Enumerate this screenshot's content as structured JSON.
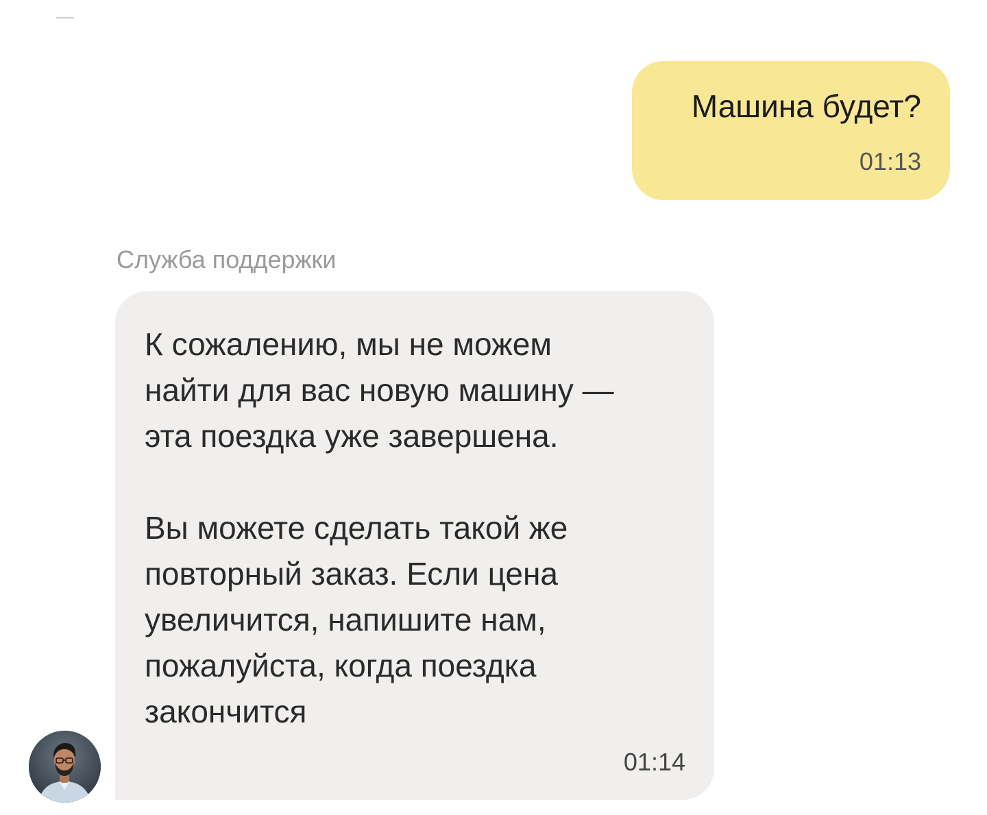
{
  "chat": {
    "outgoing": {
      "text": "Машина будет?",
      "time": "01:13"
    },
    "incoming": {
      "sender": "Служба поддержки",
      "paragraph1": [
        "К сожалению, мы не можем",
        "найти для вас новую машину —",
        "эта поездка уже завершена."
      ],
      "paragraph2": [
        "Вы можете сделать такой же",
        "повторный заказ. Если цена",
        "увеличится, напишите нам,",
        "пожалуйста, когда поездка",
        "закончится"
      ],
      "time": "01:14",
      "avatar_icon": "support-agent-avatar"
    }
  },
  "colors": {
    "outgoing_bubble": "#f8e795",
    "incoming_bubble": "#f0efed",
    "sender_label": "#9a9a9a"
  }
}
